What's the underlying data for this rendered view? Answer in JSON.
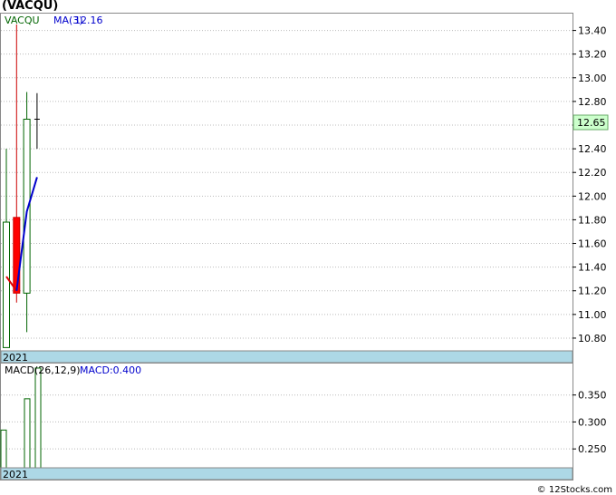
{
  "title": "(VACQU)",
  "credit": "© 12Stocks.com",
  "chart_data": [
    {
      "type": "candlestick",
      "ticker": "VACQU",
      "indicator_label": "MA(3)",
      "indicator_value": "12.16",
      "last_price": "12.65",
      "year_label": "2021",
      "ylim": [
        10.7,
        13.55
      ],
      "yticks": [
        "10.80",
        "11.00",
        "11.20",
        "11.40",
        "11.60",
        "11.80",
        "12.00",
        "12.20",
        "12.40",
        "12.60",
        "12.80",
        "13.00",
        "13.20",
        "13.40"
      ],
      "candles": [
        {
          "open": 10.72,
          "high": 12.4,
          "low": 10.72,
          "close": 11.78,
          "color": "green"
        },
        {
          "open": 11.82,
          "high": 13.45,
          "low": 11.1,
          "close": 11.18,
          "color": "red"
        },
        {
          "open": 11.18,
          "high": 12.88,
          "low": 10.85,
          "close": 12.65,
          "color": "green"
        },
        {
          "open": 12.65,
          "high": 12.87,
          "low": 12.4,
          "close": 12.65,
          "color": "black"
        }
      ],
      "ma": [
        11.32,
        11.2,
        11.87,
        12.16
      ],
      "colors": {
        "up": "#006400",
        "down": "#ff0000",
        "ma": "#0000cc",
        "price_box": "#ccffcc",
        "band": "#add8e6",
        "grid": "#bbbbbb"
      }
    },
    {
      "type": "bar",
      "indicator_label": "MACD(26,12,9)",
      "indicator_value": "MACD:0.400",
      "year_label": "2021",
      "ylim": [
        0.215,
        0.41
      ],
      "yticks": [
        "0.250",
        "0.300",
        "0.350"
      ],
      "values": [
        0.285,
        0.343,
        0.4
      ],
      "color": "#006400"
    }
  ]
}
